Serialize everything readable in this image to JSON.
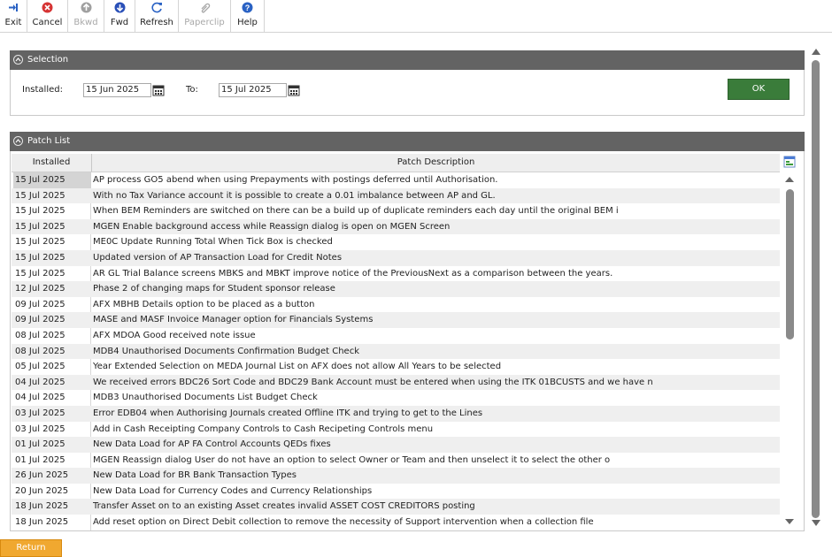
{
  "toolbar": {
    "buttons": [
      {
        "label": "Exit",
        "icon": "exit-icon"
      },
      {
        "label": "Cancel",
        "icon": "cancel-icon"
      },
      {
        "label": "Bkwd",
        "icon": "backward-icon"
      },
      {
        "label": "Fwd",
        "icon": "forward-icon"
      },
      {
        "label": "Refresh",
        "icon": "refresh-icon"
      },
      {
        "label": "Paperclip",
        "icon": "paperclip-icon"
      },
      {
        "label": "Help",
        "icon": "help-icon"
      }
    ]
  },
  "selection": {
    "title": "Selection",
    "installed_label": "Installed:",
    "installed_value": "15 Jun 2025",
    "to_label": "To:",
    "to_value": "15 Jul 2025",
    "ok_label": "OK"
  },
  "patch_list": {
    "title": "Patch List",
    "columns": [
      "Installed",
      "Patch Description"
    ],
    "rows": [
      {
        "installed": "15 Jul 2025",
        "description": "AP process GO5 abend when using Prepayments with postings deferred until Authorisation."
      },
      {
        "installed": "15 Jul 2025",
        "description": "With no Tax Variance account it is possible to create a 0.01 imbalance between AP and GL."
      },
      {
        "installed": "15 Jul 2025",
        "description": "When BEM Reminders are switched on there can be a build up of duplicate reminders each day until the original BEM i"
      },
      {
        "installed": "15 Jul 2025",
        "description": "MGEN Enable background access while Reassign dialog is open on MGEN Screen"
      },
      {
        "installed": "15 Jul 2025",
        "description": "ME0C Update Running Total When Tick Box is checked"
      },
      {
        "installed": "15 Jul 2025",
        "description": "Updated version of AP Transaction Load for Credit Notes"
      },
      {
        "installed": "15 Jul 2025",
        "description": "AR GL Trial Balance screens MBKS and MBKT improve notice of the PreviousNext as a comparison between the years."
      },
      {
        "installed": "12 Jul 2025",
        "description": "Phase 2 of changing maps for Student sponsor release"
      },
      {
        "installed": "09 Jul 2025",
        "description": "AFX MBHB Details option to be placed as a button"
      },
      {
        "installed": "09 Jul 2025",
        "description": "MASE and MASF Invoice Manager option for Financials Systems"
      },
      {
        "installed": "08 Jul 2025",
        "description": "AFX MDOA Good received note issue"
      },
      {
        "installed": "08 Jul 2025",
        "description": "MDB4 Unauthorised Documents Confirmation Budget Check"
      },
      {
        "installed": "05 Jul 2025",
        "description": "Year Extended Selection on MEDA Journal List on AFX does not allow All Years to be selected"
      },
      {
        "installed": "04 Jul 2025",
        "description": "We received errors BDC26 Sort Code and BDC29 Bank Account must be entered when using the ITK 01BCUSTS and we have n"
      },
      {
        "installed": "04 Jul 2025",
        "description": "MDB3 Unauthorised Documents List Budget Check"
      },
      {
        "installed": "03 Jul 2025",
        "description": "Error EDB04 when Authorising Journals created Offline ITK and trying to get to the Lines"
      },
      {
        "installed": "03 Jul 2025",
        "description": "Add in Cash Receipting Company Controls to Cash Recipeting Controls menu"
      },
      {
        "installed": "01 Jul 2025",
        "description": "New Data Load for AP FA Control Accounts QEDs fixes"
      },
      {
        "installed": "01 Jul 2025",
        "description": "MGEN Reassign dialog User do not have an option to select Owner or Team and then unselect it to select the other o"
      },
      {
        "installed": "26 Jun 2025",
        "description": "New Data Load for BR Bank Transaction Types"
      },
      {
        "installed": "20 Jun 2025",
        "description": "New Data Load for Currency Codes and Currency Relationships"
      },
      {
        "installed": "18 Jun 2025",
        "description": "Transfer Asset on to an existing Asset creates invalid ASSET COST CREDITORS posting"
      },
      {
        "installed": "18 Jun 2025",
        "description": "Add reset option on Direct Debit collection to remove the necessity of Support intervention when a collection file"
      }
    ]
  },
  "footer": {
    "return_label": "Return"
  },
  "colors": {
    "header_bg": "#636363",
    "ok_bg": "#3a7c3a",
    "return_bg": "#f0a830"
  }
}
